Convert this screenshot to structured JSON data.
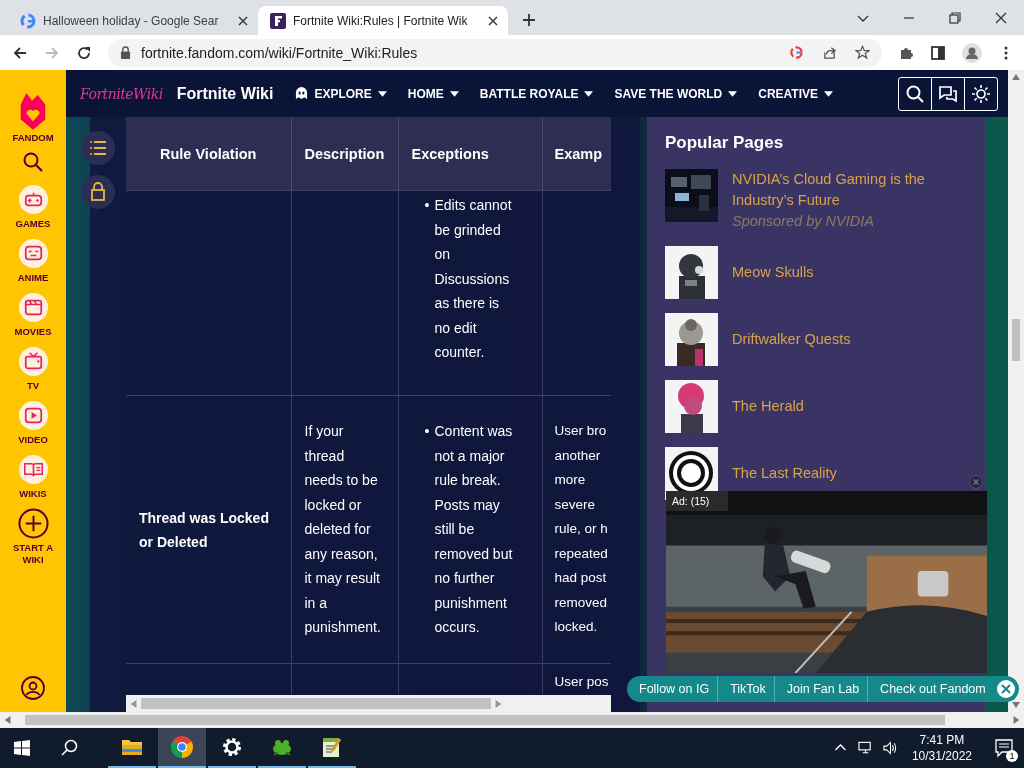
{
  "browser": {
    "tabs": [
      {
        "title": "Halloween holiday - Google Sear",
        "kind": "google",
        "selected": false
      },
      {
        "title": "Fortnite Wiki:Rules | Fortnite Wik",
        "kind": "fandom",
        "selected": true
      }
    ],
    "address": "fortnite.fandom.com/wiki/Fortnite_Wiki:Rules"
  },
  "fandom_rail": {
    "logo_label": "FANDOM",
    "items": [
      {
        "label": "GAMES",
        "kind": "games"
      },
      {
        "label": "ANIME",
        "kind": "anime"
      },
      {
        "label": "MOVIES",
        "kind": "movies"
      },
      {
        "label": "TV",
        "kind": "tv"
      },
      {
        "label": "VIDEO",
        "kind": "video"
      },
      {
        "label": "WIKIS",
        "kind": "wikis"
      },
      {
        "label": "START A WIKI",
        "kind": "add"
      }
    ]
  },
  "wiki_nav": {
    "logo": "FortniteWiki",
    "title": "Fortnite Wiki",
    "menu": [
      {
        "label": "EXPLORE",
        "kind": "explore"
      },
      {
        "label": "HOME",
        "kind": "menu"
      },
      {
        "label": "BATTLE ROYALE",
        "kind": "menu"
      },
      {
        "label": "SAVE THE WORLD",
        "kind": "menu"
      },
      {
        "label": "CREATIVE",
        "kind": "menu"
      }
    ]
  },
  "table": {
    "columns": [
      "Rule Violation",
      "Description",
      "Exceptions",
      "Examp"
    ],
    "rows": [
      {
        "exceptions": [
          {
            "bullet": "•",
            "text": "Edits cannot be grinded on Discussions as there is no edit counter."
          }
        ]
      },
      {
        "violation": "Thread was Locked or Deleted",
        "description": "If your thread needs to be locked or deleted for any reason, it may result in a punishment.",
        "exceptions": [
          {
            "bullet": "•",
            "text": "Content was not a major rule break. Posts may still be removed but no further punishment occurs."
          }
        ],
        "example": [
          "User bro",
          "another",
          "more",
          "severe",
          "rule, or h",
          "repeated",
          "had post",
          "removed",
          "locked."
        ]
      },
      {
        "example": [
          "User pos"
        ]
      }
    ]
  },
  "popular": {
    "title": "Popular Pages",
    "items": [
      {
        "title": "NVIDIA’s Cloud Gaming is the Industry’s Future",
        "sponsor": "Sponsored by NVIDIA"
      },
      {
        "title": "Meow Skulls"
      },
      {
        "title": "Driftwalker Quests"
      },
      {
        "title": "The Herald"
      },
      {
        "title": "The Last Reality"
      }
    ]
  },
  "ad": {
    "label": "Ad: (15)"
  },
  "social_bar": {
    "links": [
      "Follow on IG",
      "TikTok",
      "Join Fan Lab",
      "Check out Fandom"
    ]
  },
  "taskbar": {
    "apps": [
      {
        "kind": "explorer",
        "selected": false
      },
      {
        "kind": "chrome",
        "selected": true
      },
      {
        "kind": "settings",
        "selected": false
      },
      {
        "kind": "frog",
        "selected": false
      },
      {
        "kind": "notepad",
        "selected": false
      }
    ],
    "time": "7:41 PM",
    "date": "10/31/2022",
    "notifications": "1"
  }
}
